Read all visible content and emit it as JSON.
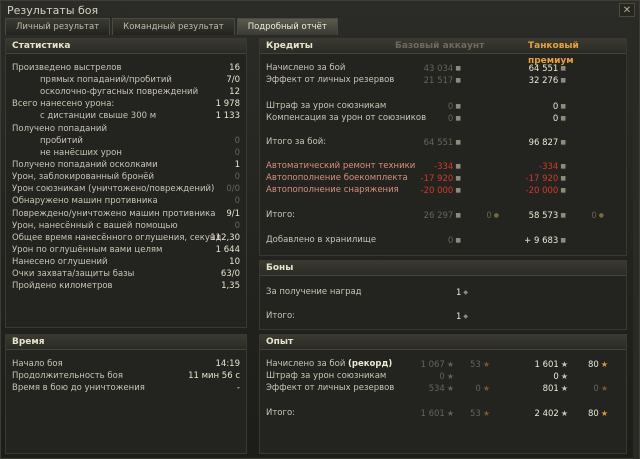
{
  "window": {
    "title": "Результаты боя",
    "close_glyph": "✕"
  },
  "tabs": [
    "Личный результат",
    "Командный результат",
    "Подробный отчёт"
  ],
  "stats": {
    "title": "Статистика",
    "rows": [
      {
        "label": "Произведено выстрелов",
        "value": "16",
        "indent": false
      },
      {
        "label": "прямых попаданий/пробитий",
        "value": "7/0",
        "indent": true
      },
      {
        "label": "осколочно-фугасных повреждений",
        "value": "12",
        "indent": true
      },
      {
        "label": "Всего нанесено урона:",
        "value": "1 978",
        "indent": false
      },
      {
        "label": "с дистанции свыше 300 м",
        "value": "1 133",
        "indent": true
      },
      {
        "label": "Получено попаданий",
        "value": "",
        "indent": false
      },
      {
        "label": "пробитий",
        "value": "0",
        "indent": true,
        "dim": true
      },
      {
        "label": "не нанёсших урон",
        "value": "0",
        "indent": true,
        "dim": true
      },
      {
        "label": "Получено попаданий осколками",
        "value": "1",
        "indent": false
      },
      {
        "label": "Урон, заблокированный бронёй",
        "value": "0",
        "indent": false,
        "dim": true
      },
      {
        "label": "Урон союзникам (уничтожено/повреждений)",
        "value": "0/0",
        "indent": false,
        "dim": true
      },
      {
        "label": "Обнаружено машин противника",
        "value": "0",
        "indent": false,
        "dim": true
      },
      {
        "label": "Повреждено/уничтожено машин противника",
        "value": "9/1",
        "indent": false
      },
      {
        "label": "Урон, нанесённый с вашей помощью",
        "value": "0",
        "indent": false,
        "dim": true
      },
      {
        "label": "Общее время нанесённого оглушения, секунд",
        "value": "112,30",
        "indent": false
      },
      {
        "label": "Урон по оглушённым вами целям",
        "value": "1 644",
        "indent": false
      },
      {
        "label": "Нанесено оглушений",
        "value": "10",
        "indent": false
      },
      {
        "label": "Очки захвата/защиты базы",
        "value": "63/0",
        "indent": false
      },
      {
        "label": "Пройдено километров",
        "value": "1,35",
        "indent": false
      }
    ]
  },
  "time": {
    "title": "Время",
    "rows": [
      {
        "label": "Начало боя",
        "value": "14:19"
      },
      {
        "label": "Продолжительность боя",
        "value": "11 мин 56 с"
      },
      {
        "label": "Время в бою до уничтожения",
        "value": "-"
      }
    ]
  },
  "credits": {
    "title": "Кредиты",
    "col_basic": "Базовый аккаунт",
    "col_premium": "Танковый премиум",
    "rows": [
      {
        "label": "Начислено за бой",
        "basic": "43 034",
        "premium": "64 551"
      },
      {
        "label": "Эффект от личных резервов",
        "basic": "21 517",
        "premium": "32 276"
      },
      {
        "label": "Штраф за урон союзникам",
        "basic": "0",
        "premium": "0"
      },
      {
        "label": "Компенсация за урон от союзников",
        "basic": "0",
        "premium": "0"
      },
      {
        "label": "Итого за бой:",
        "basic": "64 551",
        "premium": "96 827"
      },
      {
        "label": "Автоматический ремонт техники",
        "basic": "-334",
        "premium": "-334",
        "red": true
      },
      {
        "label": "Автопополнение боекомплекта",
        "basic": "-17 920",
        "premium": "-17 920",
        "red": true
      },
      {
        "label": "Автопополнение снаряжения",
        "basic": "-20 000",
        "premium": "-20 000",
        "red": true
      },
      {
        "label": "Итого:",
        "basic": "26 297",
        "basic_gold": "0",
        "premium": "58 573",
        "premium_gold": "0"
      },
      {
        "label": "Добавлено в хранилище",
        "basic": "0",
        "premium": "+ 9 683"
      }
    ]
  },
  "bonds": {
    "title": "Боны",
    "rows": [
      {
        "label": "За получение наград",
        "value": "1"
      },
      {
        "label": "Итого:",
        "value": "1"
      }
    ]
  },
  "experience": {
    "title": "Опыт",
    "rows": [
      {
        "label": "Начислено за бой ",
        "label_bold": "(рекорд)",
        "basic": "1 067",
        "basic_free": "53",
        "premium": "1 601",
        "premium_free": "80"
      },
      {
        "label": "Штраф за урон союзникам",
        "basic": "0",
        "premium": "0"
      },
      {
        "label": "Эффект от личных резервов",
        "basic": "534",
        "basic_free": "0",
        "premium": "801",
        "premium_free": "0"
      },
      {
        "label": "Итого:",
        "basic": "1 601",
        "basic_free": "53",
        "premium": "2 402",
        "premium_free": "80"
      }
    ]
  },
  "icons": {
    "credit": "credit-icon",
    "bond": "bond-icon",
    "xp": "xp-star-icon",
    "free_xp": "free-xp-star-icon"
  },
  "colors": {
    "premium_header": "#e8a23a",
    "negative": "#d33a2c",
    "free_xp_star": "#e09a30"
  }
}
